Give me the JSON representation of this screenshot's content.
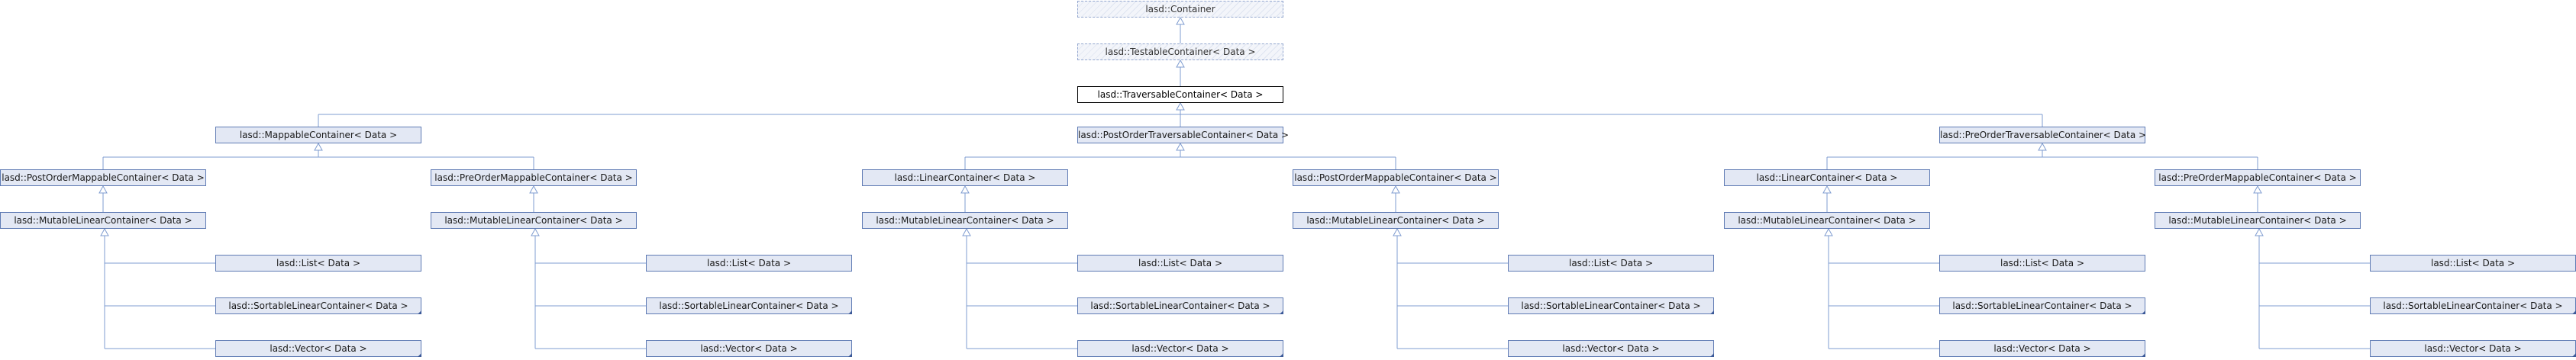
{
  "diagram": {
    "title": "",
    "colors": {
      "edge": "#7f9cd0",
      "node_fill": "#e3e8f4",
      "node_border": "#5f7bb4",
      "focus_border": "#000000"
    },
    "labels": {
      "container": "lasd::Container",
      "testable": "lasd::TestableContainer< Data >",
      "traversable": "lasd::TraversableContainer< Data >",
      "mappable": "lasd::MappableContainer< Data >",
      "post_order_traversable": "lasd::PostOrderTraversableContainer< Data >",
      "pre_order_traversable": "lasd::PreOrderTraversableContainer< Data >",
      "post_order_mappable": "lasd::PostOrderMappableContainer< Data >",
      "pre_order_mappable": "lasd::PreOrderMappableContainer< Data >",
      "linear": "lasd::LinearContainer< Data >",
      "mutable_linear": "lasd::MutableLinearContainer< Data >",
      "list": "lasd::List< Data >",
      "sortable_linear": "lasd::SortableLinearContainer< Data >",
      "vector": "lasd::Vector< Data >"
    }
  }
}
